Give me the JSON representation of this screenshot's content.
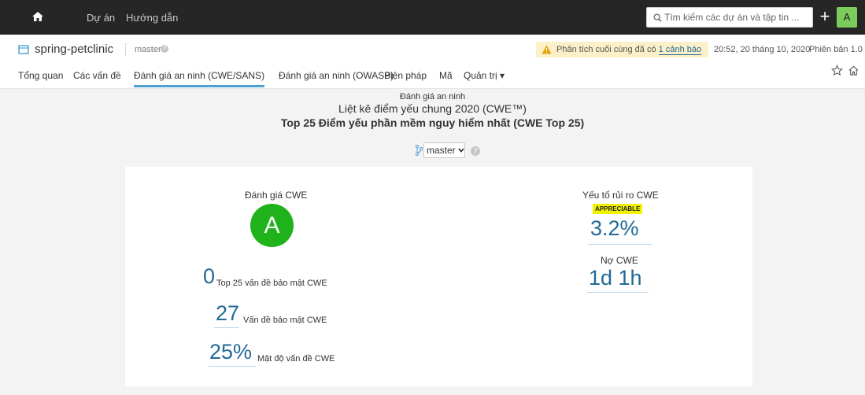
{
  "topnav": {
    "projects_label": "Dự án",
    "guide_label": "Hướng dẫn",
    "search_placeholder": "Tìm kiếm các dự án và tập tin ...",
    "plus_label": "+",
    "avatar_letter": "A"
  },
  "project": {
    "name": "spring-petclinic",
    "branch": "master",
    "branch_help": "?",
    "warning_prefix": "Phân tích cuối cùng đã có",
    "warning_link": "1 cảnh báo",
    "analysis_date": "20:52, 20 tháng 10, 2020",
    "version": "Phiên bản 1.0"
  },
  "tabs": [
    {
      "label": "Tổng quan"
    },
    {
      "label": "Các vấn đề"
    },
    {
      "label": "Đánh giá an ninh (CWE/SANS)"
    },
    {
      "label": "Đánh giá an ninh (OWASP)"
    },
    {
      "label": "Biện pháp"
    },
    {
      "label": "Mã"
    },
    {
      "label": "Quản trị ▾"
    }
  ],
  "report": {
    "type": "Đánh giá an ninh",
    "title1": "Liệt kê điểm yếu chung 2020 (CWE™)",
    "title2": "Top 25 Điểm yếu phần mềm nguy hiểm nhất (CWE Top 25)",
    "branch_select": "master",
    "help": "?"
  },
  "card": {
    "grade_label": "Đánh giá CWE",
    "grade": "A",
    "top25_value": "0",
    "top25_label": "Top 25 vấn đề bảo mật CWE",
    "issues_value": "27",
    "issues_label": "Vấn đề bảo mật CWE",
    "density_value": "25%",
    "density_label": "Mật độ vấn đề CWE",
    "risk_label": "Yếu tố rủi ro CWE",
    "risk_badge": "APPRECIABLE",
    "risk_value": "3.2%",
    "debt_label": "Nợ CWE",
    "debt_value": "1d 1h"
  },
  "colors": {
    "topbar": "#262626",
    "grade_green": "#1fb21a",
    "link_blue": "#236a97",
    "active_tab": "#4b9fd5",
    "badge_yellow": "#f1f100",
    "warning_bg": "#fcf0c9"
  },
  "icons": [
    "home-icon",
    "search-icon",
    "project-icon",
    "warning-icon",
    "star-icon",
    "house-outline-icon",
    "branch-icon",
    "chevron-down-icon"
  ]
}
